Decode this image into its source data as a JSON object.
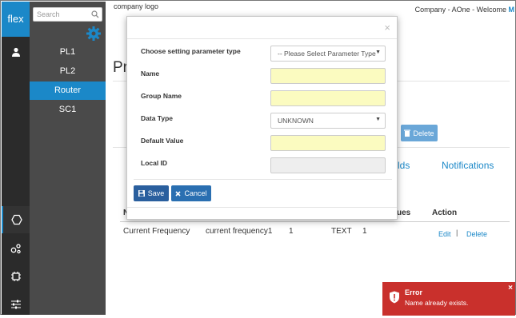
{
  "rail": {
    "brand": "flex",
    "icons": [
      "user-icon",
      "hexagon-icon",
      "share-nodes-icon",
      "chip-icon",
      "sliders-icon"
    ]
  },
  "nav": {
    "search_placeholder": "Search",
    "items": [
      {
        "label": "PL1",
        "active": false
      },
      {
        "label": "PL2",
        "active": false
      },
      {
        "label": "Router",
        "active": true
      },
      {
        "label": "SC1",
        "active": false
      }
    ]
  },
  "header": {
    "logo_text": "company logo",
    "company_text": "Company - AOne - Welcome",
    "user_initial": "M"
  },
  "page": {
    "title_fragment": "Pr",
    "delete_label": "Delete",
    "tabs": [
      {
        "label": "lds"
      },
      {
        "label": "Notifications"
      }
    ],
    "table": {
      "headers": [
        "N",
        "ues",
        "Action"
      ],
      "row": {
        "name": "Current Frequency",
        "key": "current frequency1",
        "col3": "1",
        "type": "TEXT",
        "col5": "1",
        "edit": "Edit",
        "sep": "|",
        "delete": "Delete"
      }
    }
  },
  "modal": {
    "close": "×",
    "fields": {
      "param_type": {
        "label": "Choose setting parameter type",
        "value": "-- Please Select Parameter Type"
      },
      "name": {
        "label": "Name",
        "value": ""
      },
      "group_name": {
        "label": "Group Name",
        "value": ""
      },
      "data_type": {
        "label": "Data Type",
        "value": "UNKNOWN"
      },
      "default_value": {
        "label": "Default Value",
        "value": ""
      },
      "local_id": {
        "label": "Local ID",
        "value": ""
      }
    },
    "save_label": "Save",
    "cancel_label": "Cancel"
  },
  "toast": {
    "title": "Error",
    "message": "Name already exists.",
    "close": "×"
  },
  "colors": {
    "accent": "#1b88c8",
    "error": "#c9302c",
    "input_highlight": "#fbfbc0"
  }
}
